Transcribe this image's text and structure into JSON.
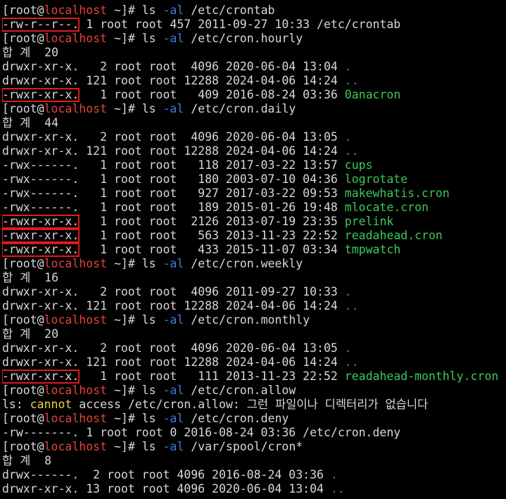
{
  "terminal": {
    "lines": [
      [
        {
          "t": "[root@"
        },
        {
          "t": "localhost",
          "c": "host"
        },
        {
          "t": " ~]# ls "
        },
        {
          "t": "-al",
          "c": "flag"
        },
        {
          "t": " /etc/crontab"
        }
      ],
      [
        {
          "t": "-rw-r--r--.",
          "hl": true
        },
        {
          "t": " 1 root root 457 2011-09-27 10:33 /etc/crontab"
        }
      ],
      [
        {
          "t": "[root@"
        },
        {
          "t": "localhost",
          "c": "host"
        },
        {
          "t": " ~]# ls "
        },
        {
          "t": "-al",
          "c": "flag"
        },
        {
          "t": " /etc/cron.hourly"
        }
      ],
      [
        {
          "t": "합 계  20"
        }
      ],
      [
        {
          "t": "drwxr-xr-x.   2 root root  4096 2020-06-04 13:04 "
        },
        {
          "t": ".",
          "c": "dir"
        }
      ],
      [
        {
          "t": "drwxr-xr-x. 121 root root 12288 2024-04-06 14:24 "
        },
        {
          "t": "..",
          "c": "dir"
        }
      ],
      [
        {
          "t": "-rwxr-xr-x.",
          "hl": true
        },
        {
          "t": "   1 root root   409 2016-08-24 03:36 "
        },
        {
          "t": "0anacron",
          "c": "exe"
        }
      ],
      [
        {
          "t": "[root@"
        },
        {
          "t": "localhost",
          "c": "host"
        },
        {
          "t": " ~]# ls "
        },
        {
          "t": "-al",
          "c": "flag"
        },
        {
          "t": " /etc/cron.daily"
        }
      ],
      [
        {
          "t": "합 계  44"
        }
      ],
      [
        {
          "t": "drwxr-xr-x.   2 root root  4096 2020-06-04 13:05 "
        },
        {
          "t": ".",
          "c": "dir"
        }
      ],
      [
        {
          "t": "drwxr-xr-x. 121 root root 12288 2024-04-06 14:24 "
        },
        {
          "t": "..",
          "c": "dir"
        }
      ],
      [
        {
          "t": "-rwx------.   1 root root   118 2017-03-22 13:57 "
        },
        {
          "t": "cups",
          "c": "exe"
        }
      ],
      [
        {
          "t": "-rwx------.   1 root root   180 2003-07-10 04:36 "
        },
        {
          "t": "logrotate",
          "c": "exe"
        }
      ],
      [
        {
          "t": "-rwx------.   1 root root   927 2017-03-22 09:53 "
        },
        {
          "t": "makewhatis.cron",
          "c": "exe"
        }
      ],
      [
        {
          "t": "-rwx------.   1 root root   189 2015-01-26 19:48 "
        },
        {
          "t": "mlocate.cron",
          "c": "exe"
        }
      ],
      [
        {
          "t": "-rwxr-xr-x.",
          "hl": true
        },
        {
          "t": "   1 root root  2126 2013-07-19 23:35 "
        },
        {
          "t": "prelink",
          "c": "exe"
        }
      ],
      [
        {
          "t": "-rwxr-xr-x.",
          "hl": true
        },
        {
          "t": "   1 root root   563 2013-11-23 22:52 "
        },
        {
          "t": "readahead.cron",
          "c": "exe"
        }
      ],
      [
        {
          "t": "-rwxr-xr-x.",
          "hl": true
        },
        {
          "t": "   1 root root   433 2015-11-07 03:34 "
        },
        {
          "t": "tmpwatch",
          "c": "exe"
        }
      ],
      [
        {
          "t": "[root@"
        },
        {
          "t": "localhost",
          "c": "host"
        },
        {
          "t": " ~]# ls "
        },
        {
          "t": "-al",
          "c": "flag"
        },
        {
          "t": " /etc/cron.weekly"
        }
      ],
      [
        {
          "t": "합 계  16"
        }
      ],
      [
        {
          "t": "drwxr-xr-x.   2 root root  4096 2011-09-27 10:33 "
        },
        {
          "t": ".",
          "c": "dir"
        }
      ],
      [
        {
          "t": "drwxr-xr-x. 121 root root 12288 2024-04-06 14:24 "
        },
        {
          "t": "..",
          "c": "dir"
        }
      ],
      [
        {
          "t": "[root@"
        },
        {
          "t": "localhost",
          "c": "host"
        },
        {
          "t": " ~]# ls "
        },
        {
          "t": "-al",
          "c": "flag"
        },
        {
          "t": " /etc/cron.monthly"
        }
      ],
      [
        {
          "t": "합 계  20"
        }
      ],
      [
        {
          "t": "drwxr-xr-x.   2 root root  4096 2020-06-04 13:05 "
        },
        {
          "t": ".",
          "c": "dir"
        }
      ],
      [
        {
          "t": "drwxr-xr-x. 121 root root 12288 2024-04-06 14:24 "
        },
        {
          "t": "..",
          "c": "dir"
        }
      ],
      [
        {
          "t": "-rwxr-xr-x.",
          "hl": true
        },
        {
          "t": "   1 root root   111 2013-11-23 22:52 "
        },
        {
          "t": "readahead-monthly.cron",
          "c": "exe"
        }
      ],
      [
        {
          "t": "[root@"
        },
        {
          "t": "localhost",
          "c": "host"
        },
        {
          "t": " ~]# ls "
        },
        {
          "t": "-al",
          "c": "flag"
        },
        {
          "t": " /etc/cron.allow"
        }
      ],
      [
        {
          "t": "ls: "
        },
        {
          "t": "cannot",
          "c": "warn"
        },
        {
          "t": " access /etc/cron.allow: 그런 파일이나 디렉터리가 없습니다"
        }
      ],
      [
        {
          "t": "[root@"
        },
        {
          "t": "localhost",
          "c": "host"
        },
        {
          "t": " ~]# ls "
        },
        {
          "t": "-al",
          "c": "flag"
        },
        {
          "t": " /etc/cron.deny"
        }
      ],
      [
        {
          "t": "-rw-------. 1 root root 0 2016-08-24 03:36 /etc/cron.deny"
        }
      ],
      [
        {
          "t": "[root@"
        },
        {
          "t": "localhost",
          "c": "host"
        },
        {
          "t": " ~]# ls "
        },
        {
          "t": "-al",
          "c": "flag"
        },
        {
          "t": " /var/spool/cron*"
        }
      ],
      [
        {
          "t": "합 계  8"
        }
      ],
      [
        {
          "t": "drwx------.  2 root root 4096 2016-08-24 03:36 "
        },
        {
          "t": ".",
          "c": "dir"
        }
      ],
      [
        {
          "t": "drwxr-xr-x. 13 root root 4096 2020-06-04 13:04 "
        },
        {
          "t": "..",
          "c": "dir"
        }
      ]
    ]
  }
}
